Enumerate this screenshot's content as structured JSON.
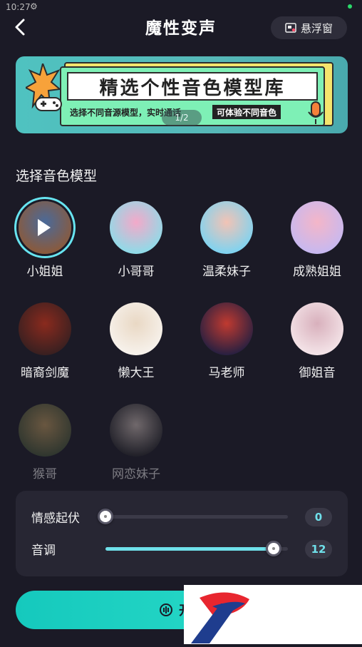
{
  "status_bar": {
    "time": "10:27",
    "gear_glyph": "⚙"
  },
  "header": {
    "title": "魔性变声",
    "float_label": "悬浮窗"
  },
  "banner": {
    "headline": "精选个性音色模型库",
    "subline": "选择不同音源模型，实时通话",
    "tag": "可体验不同音色",
    "pager": "1/2"
  },
  "section": {
    "label": "选择音色模型"
  },
  "voices": [
    {
      "name": "小姐姐",
      "selected": true,
      "available": true,
      "colors": [
        "#8a5a3c",
        "#4a6a9a"
      ]
    },
    {
      "name": "小哥哥",
      "selected": false,
      "available": true,
      "colors": [
        "#8fdbe8",
        "#f3a9c9"
      ]
    },
    {
      "name": "温柔妹子",
      "selected": false,
      "available": true,
      "colors": [
        "#7fd3f0",
        "#f2c3b5"
      ]
    },
    {
      "name": "成熟姐姐",
      "selected": false,
      "available": true,
      "colors": [
        "#c7b8f0",
        "#f4b6c8"
      ]
    },
    {
      "name": "暗裔剑魔",
      "selected": false,
      "available": true,
      "colors": [
        "#3a2020",
        "#8a2a1e"
      ]
    },
    {
      "name": "懒大王",
      "selected": false,
      "available": true,
      "colors": [
        "#f7f2ec",
        "#e9d8c4"
      ]
    },
    {
      "name": "马老师",
      "selected": false,
      "available": true,
      "colors": [
        "#2a2040",
        "#c03a30"
      ]
    },
    {
      "name": "御姐音",
      "selected": false,
      "available": true,
      "colors": [
        "#f4e4e8",
        "#d8b0bc"
      ]
    },
    {
      "name": "猴哥",
      "selected": false,
      "available": false,
      "colors": [
        "#4a5a3a",
        "#c8a060"
      ]
    },
    {
      "name": "网恋妹子",
      "selected": false,
      "available": false,
      "colors": [
        "#2a2a2e",
        "#d8c8c0"
      ]
    }
  ],
  "controls": {
    "emotion": {
      "label": "情感起伏",
      "value": "0",
      "fraction": 0.0
    },
    "pitch": {
      "label": "音调",
      "value": "12",
      "fraction": 0.92
    }
  },
  "start_button": {
    "label": "开启"
  }
}
